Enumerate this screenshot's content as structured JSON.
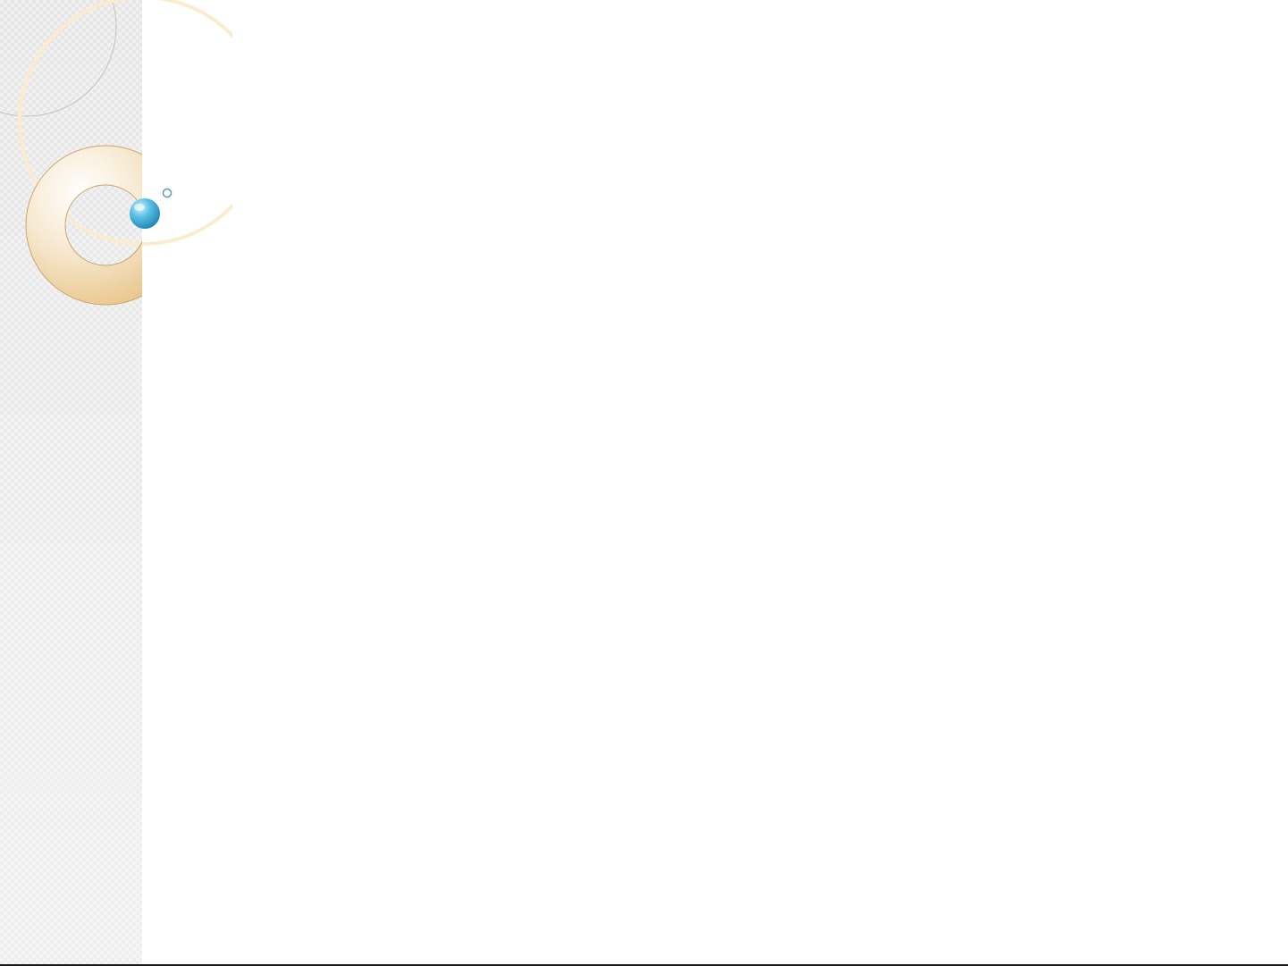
{
  "slide": {
    "background_color": "#ffffff",
    "side_strip_color": "#f0f0f0",
    "ring_color": "#e9c98f",
    "sphere_color": "#2aa6cf",
    "bottom_line_color": "#1a1a1a"
  },
  "icons": [
    "ring-icon",
    "sphere-icon",
    "small-circle-icon"
  ]
}
